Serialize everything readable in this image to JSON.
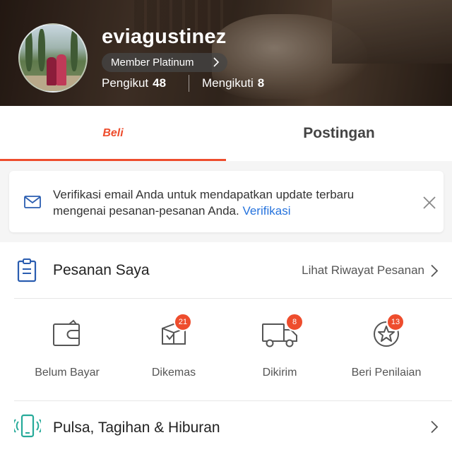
{
  "profile": {
    "username": "eviagustinez",
    "member_label": "Member Platinum",
    "followers_label": "Pengikut",
    "followers_count": "48",
    "following_label": "Mengikuti",
    "following_count": "8"
  },
  "tabs": [
    {
      "label": "Beli",
      "active": true
    },
    {
      "label": "Postingan",
      "active": false
    }
  ],
  "verify_banner": {
    "text": "Verifikasi email Anda untuk mendapatkan update terbaru mengenai pesanan-pesanan Anda.",
    "link": "Verifikasi",
    "icon": "mail-icon",
    "close_icon": "close-icon"
  },
  "orders": {
    "title": "Pesanan Saya",
    "history_link": "Lihat Riwayat Pesanan",
    "statuses": [
      {
        "label": "Belum Bayar",
        "icon": "wallet-icon",
        "badge": ""
      },
      {
        "label": "Dikemas",
        "icon": "package-icon",
        "badge": "21"
      },
      {
        "label": "Dikirim",
        "icon": "truck-icon",
        "badge": "8"
      },
      {
        "label": "Beri Penilaian",
        "icon": "star-rating-icon",
        "badge": "13"
      }
    ]
  },
  "pulsa": {
    "title": "Pulsa, Tagihan & Hiburan",
    "icon": "phone-icon"
  },
  "colors": {
    "accent": "#ee4d2d",
    "link": "#2673dd",
    "phone_icon": "#26aa99",
    "orders_icon": "#2a5db0"
  }
}
